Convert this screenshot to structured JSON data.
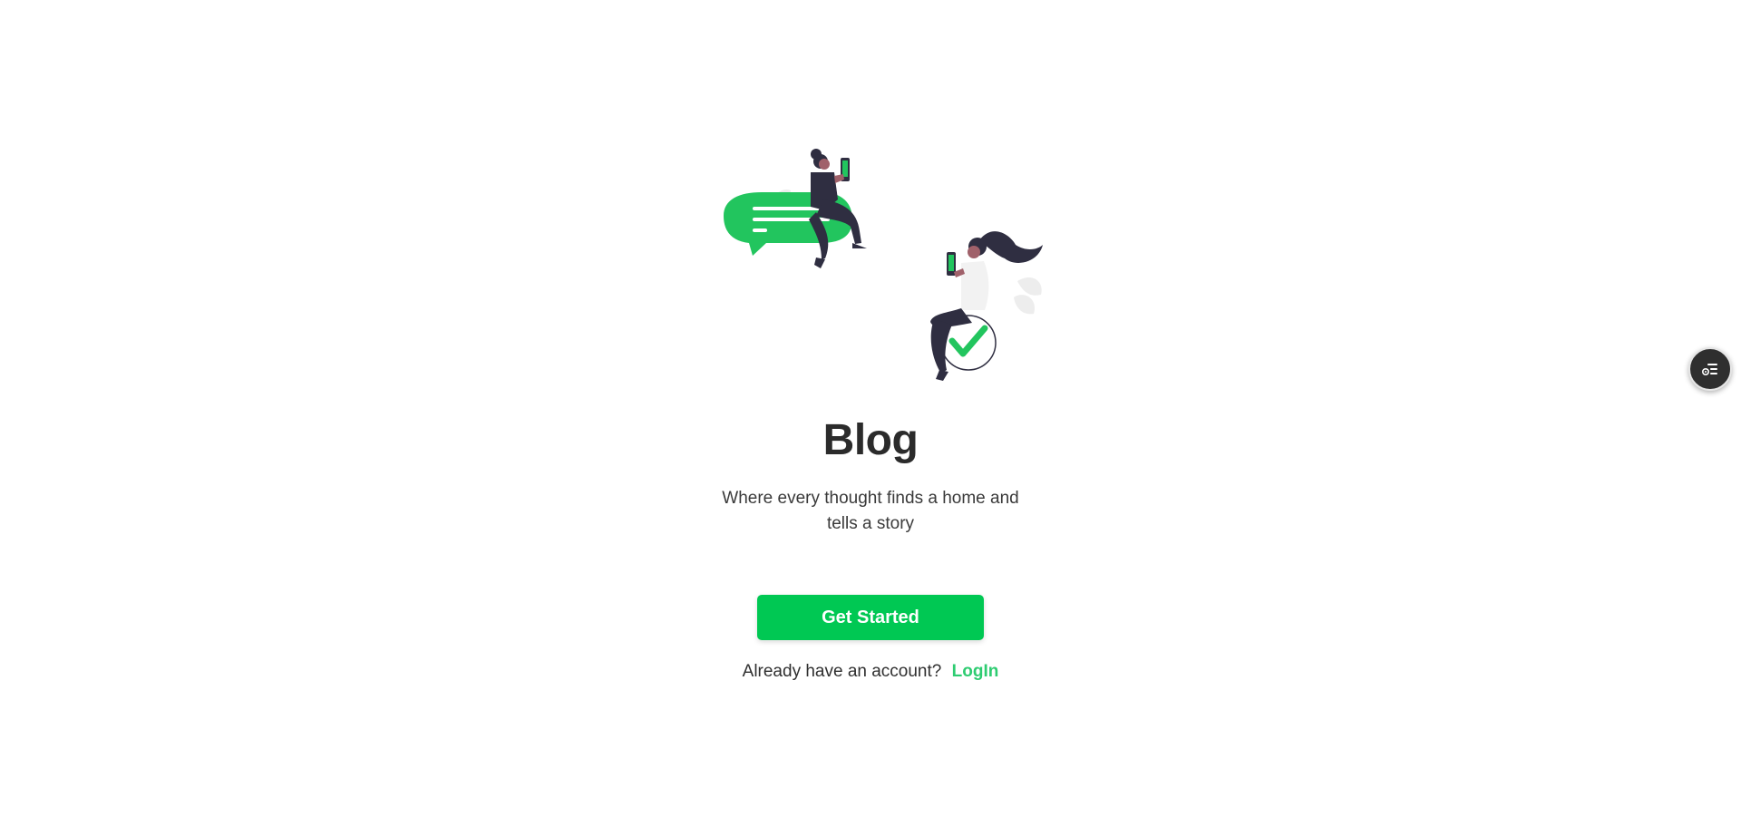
{
  "hero": {
    "title": "Blog",
    "subtitle": "Where every thought finds a home and tells a story",
    "cta_label": "Get Started",
    "login_prompt": "Already have an account?",
    "login_label": "LogIn"
  },
  "floating_button": {
    "icon": "list-settings-icon"
  },
  "colors": {
    "accent": "#00c853",
    "link": "#2ecc71",
    "text": "#2b2b2b",
    "figure_dark": "#2f2e41"
  },
  "illustration": {
    "icon": "people-chatting-illustration"
  }
}
